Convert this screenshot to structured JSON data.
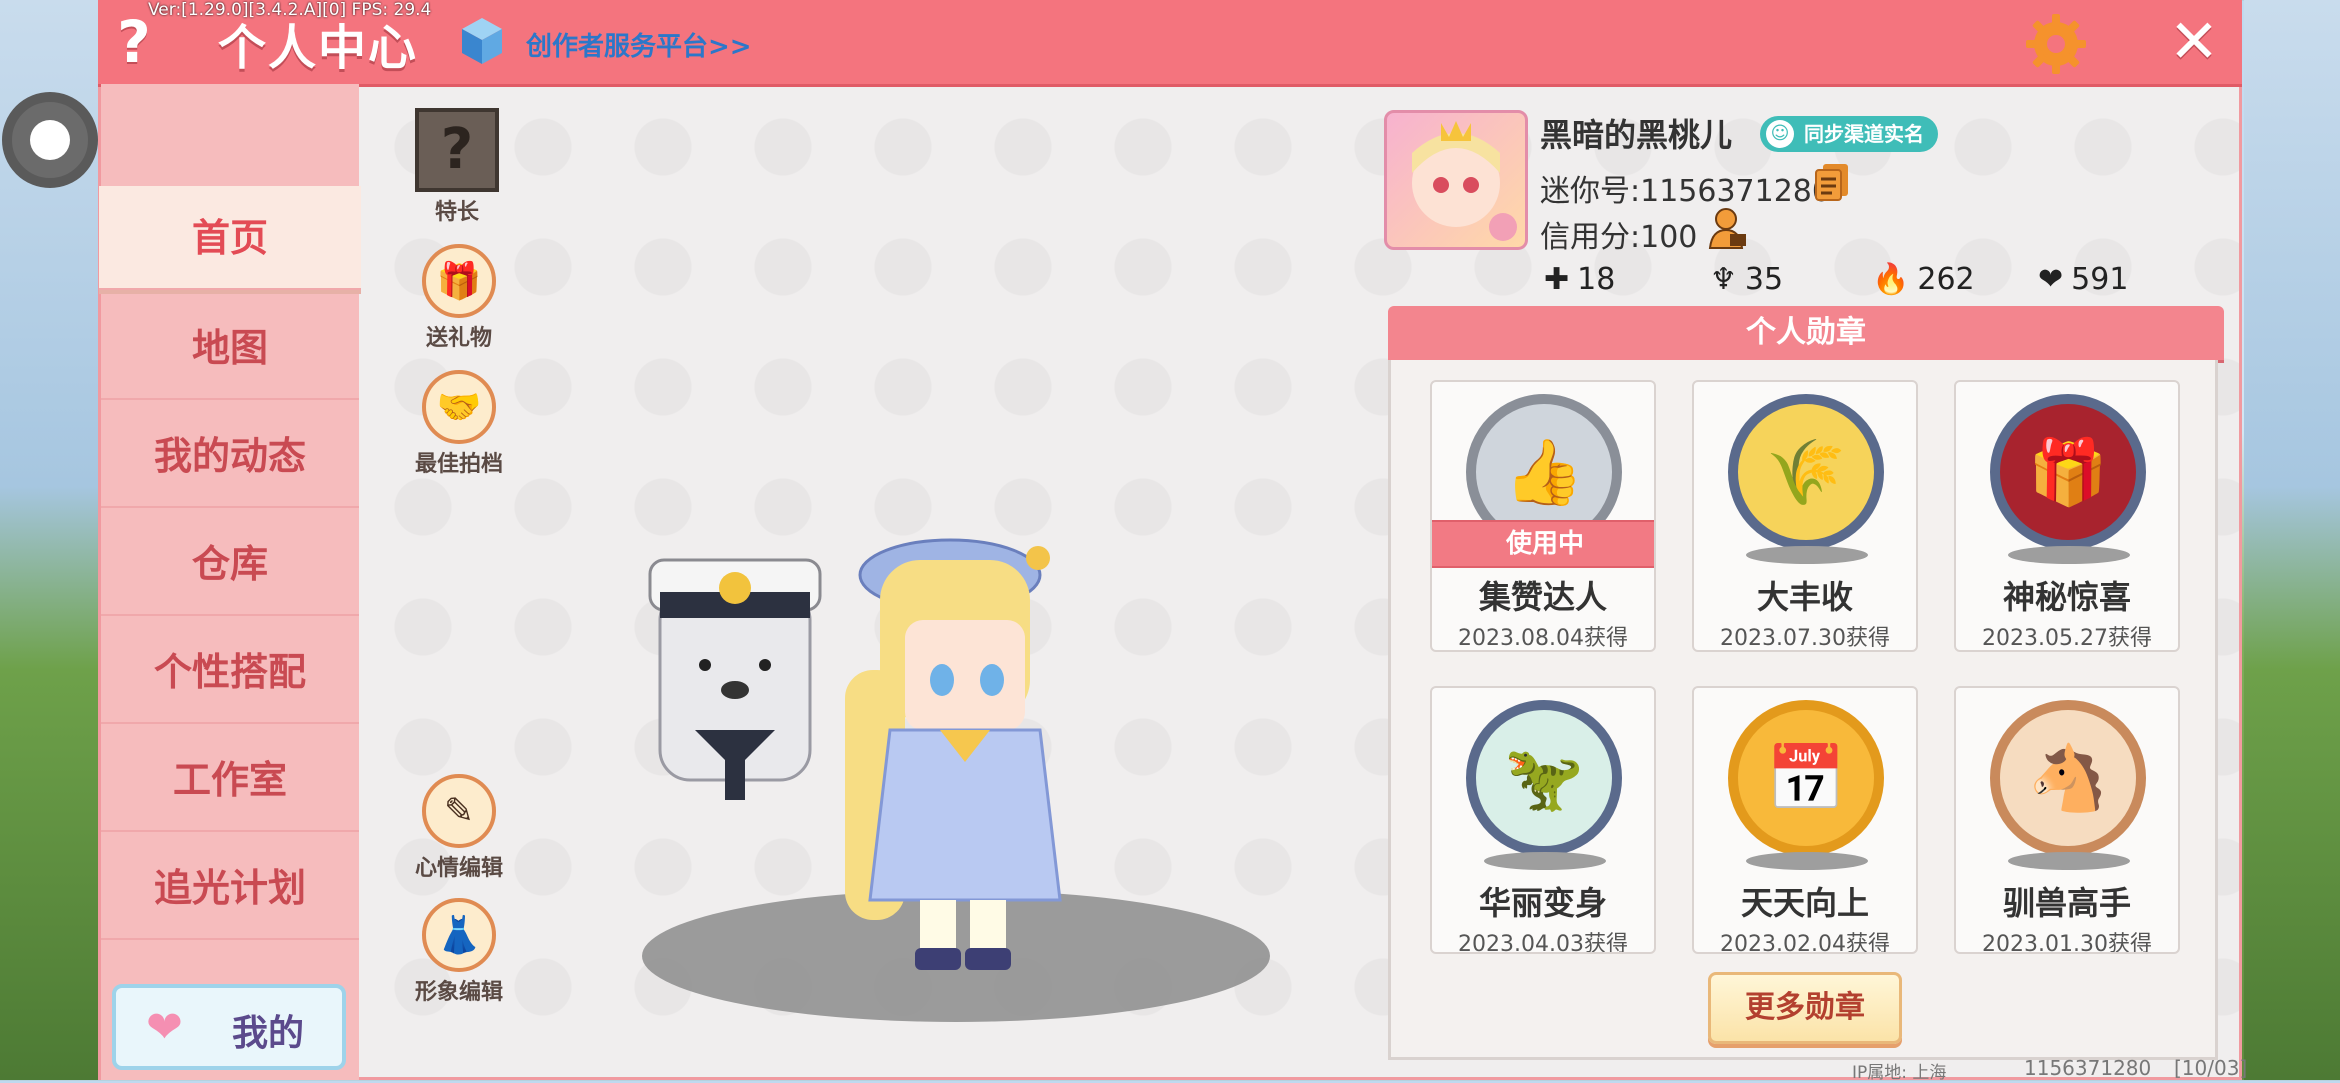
{
  "debug": {
    "version": "Ver:[1.29.0][3.4.2.A][0] FPS: 29.4"
  },
  "header": {
    "help_icon": "question-mark-icon",
    "title": "个人中心",
    "creator_link": "创作者服务平台>>",
    "settings_icon": "gear-icon",
    "close_icon": "close-icon",
    "accent_color": "#f4747e"
  },
  "sidebar": {
    "items": [
      {
        "label": "首页",
        "active": true
      },
      {
        "label": "地图"
      },
      {
        "label": "我的动态"
      },
      {
        "label": "仓库"
      },
      {
        "label": "个性搭配"
      },
      {
        "label": "工作室"
      },
      {
        "label": "追光计划"
      }
    ],
    "me_button": {
      "label": "我的",
      "icon": "heart-icon"
    }
  },
  "tools": {
    "specialty": "特长",
    "gift": "送礼物",
    "partner": "最佳拍档",
    "mood_edit": "心情编辑",
    "look_edit": "形象编辑"
  },
  "profile": {
    "nickname": "黑暗的黑桃儿",
    "realname_badge": "同步渠道实名",
    "mini_id": "迷你号:1156371280",
    "credit": "信用分:100",
    "stats": {
      "bookmarks": "18",
      "followers": "35",
      "popularity": "262",
      "likes": "591"
    }
  },
  "medals": {
    "header": "个人勋章",
    "in_use_label": "使用中",
    "more_button": "更多勋章",
    "items": [
      {
        "name": "集赞达人",
        "date": "2023.08.04获得",
        "in_use": true,
        "ring": "#8a8f98",
        "fill": "#cfd5dc",
        "symbol": "👍"
      },
      {
        "name": "大丰收",
        "date": "2023.07.30获得",
        "ring": "#5a6a8c",
        "fill": "#f6d35a",
        "symbol": "🌾"
      },
      {
        "name": "神秘惊喜",
        "date": "2023.05.27获得",
        "ring": "#5a6a8c",
        "fill": "#a8232e",
        "symbol": "🎁"
      },
      {
        "name": "华丽变身",
        "date": "2023.04.03获得",
        "ring": "#5a6a8c",
        "fill": "#d9efe8",
        "symbol": "🦖"
      },
      {
        "name": "天天向上",
        "date": "2023.02.04获得",
        "ring": "#e39a1c",
        "fill": "#f8b93a",
        "symbol": "📅"
      },
      {
        "name": "驯兽高手",
        "date": "2023.01.30获得",
        "ring": "#c98a5c",
        "fill": "#f6dcc0",
        "symbol": "🐴"
      }
    ]
  },
  "footer": {
    "ip": "IP属地: 上海",
    "uid": "1156371280",
    "ver": "[10/03]"
  }
}
